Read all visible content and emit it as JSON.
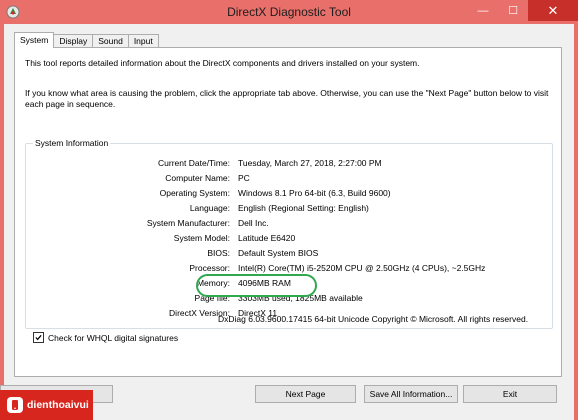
{
  "window": {
    "title": "DirectX Diagnostic Tool",
    "minimize_glyph": "—",
    "maximize_glyph": "☐",
    "close_glyph": "✕"
  },
  "tabs": [
    {
      "label": "System"
    },
    {
      "label": "Display"
    },
    {
      "label": "Sound"
    },
    {
      "label": "Input"
    }
  ],
  "intro": {
    "line1": "This tool reports detailed information about the DirectX components and drivers installed on your system.",
    "line2": "If you know what area is causing the problem, click the appropriate tab above.  Otherwise, you can use the \"Next Page\" button below to visit each page in sequence."
  },
  "system_info": {
    "group_label": "System Information",
    "rows": [
      {
        "label": "Current Date/Time:",
        "value": "Tuesday, March 27, 2018, 2:27:00 PM"
      },
      {
        "label": "Computer Name:",
        "value": "PC"
      },
      {
        "label": "Operating System:",
        "value": "Windows 8.1 Pro 64-bit (6.3, Build 9600)"
      },
      {
        "label": "Language:",
        "value": "English (Regional Setting: English)"
      },
      {
        "label": "System Manufacturer:",
        "value": "Dell Inc."
      },
      {
        "label": "System Model:",
        "value": "Latitude E6420"
      },
      {
        "label": "BIOS:",
        "value": "Default System BIOS"
      },
      {
        "label": "Processor:",
        "value": "Intel(R) Core(TM) i5-2520M CPU @ 2.50GHz (4 CPUs), ~2.5GHz"
      },
      {
        "label": "Memory:",
        "value": "4096MB RAM"
      },
      {
        "label": "Page file:",
        "value": "3303MB used, 1825MB available"
      },
      {
        "label": "DirectX Version:",
        "value": "DirectX 11"
      }
    ]
  },
  "whql": {
    "label": "Check for WHQL digital signatures",
    "checked": true
  },
  "version_line": "DxDiag 6.03.9600.17415 64-bit Unicode  Copyright © Microsoft. All rights reserved.",
  "buttons": {
    "help": "",
    "next_page": "Next Page",
    "save_all": "Save All Information...",
    "exit": "Exit"
  },
  "watermark": {
    "text": "dienthoaivui"
  },
  "colors": {
    "titlebar": "#e86f6a",
    "close": "#c7302a",
    "highlight": "#2fa84f",
    "watermark": "#d7261e"
  }
}
